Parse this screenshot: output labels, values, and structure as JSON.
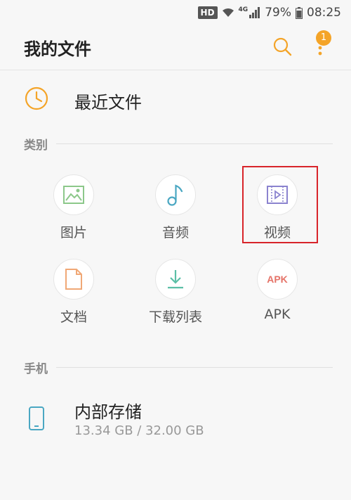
{
  "status_bar": {
    "hd": "HD",
    "network": "4G",
    "battery": "79%",
    "time": "08:25"
  },
  "app_bar": {
    "title": "我的文件",
    "notification_count": "1"
  },
  "recent": {
    "label": "最近文件"
  },
  "categories_section": {
    "label": "类别",
    "items": [
      {
        "label": "图片",
        "icon": "image-icon"
      },
      {
        "label": "音频",
        "icon": "music-note-icon"
      },
      {
        "label": "视频",
        "icon": "video-icon"
      },
      {
        "label": "文档",
        "icon": "document-icon"
      },
      {
        "label": "下载列表",
        "icon": "download-icon"
      },
      {
        "label": "APK",
        "icon": "apk-icon",
        "icon_text": "APK"
      }
    ]
  },
  "phone_section": {
    "label": "手机",
    "storage": {
      "title": "内部存储",
      "size": "13.34 GB / 32.00 GB"
    }
  },
  "colors": {
    "accent": "#f4a428",
    "highlight": "#d8242a"
  }
}
